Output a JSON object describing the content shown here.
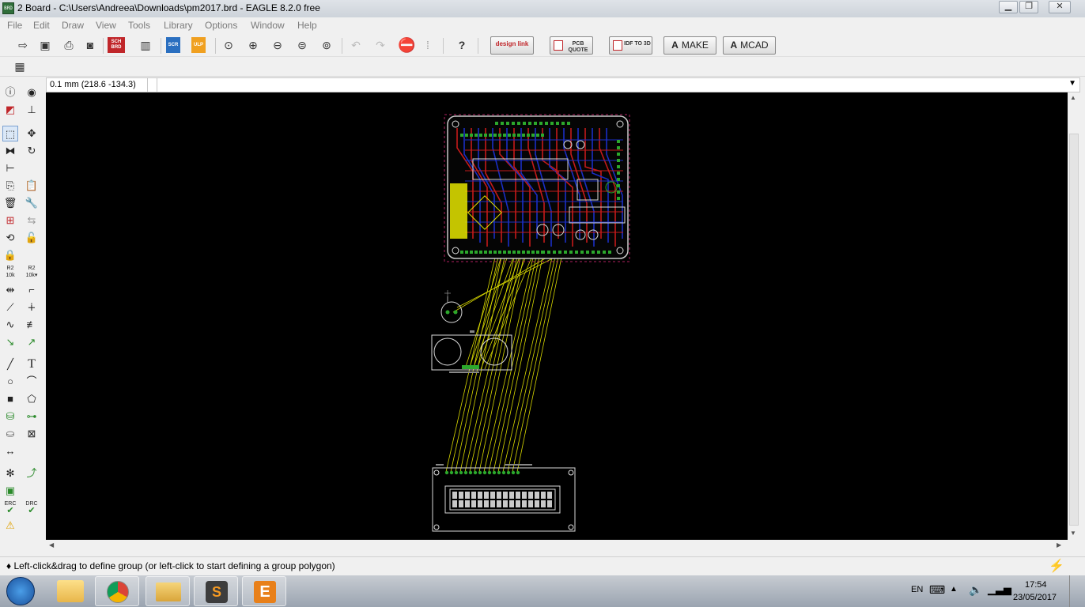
{
  "window": {
    "title": "2 Board - C:\\Users\\Andreea\\Downloads\\pm2017.brd - EAGLE 8.2.0 free",
    "app_icon_label": "BRD",
    "controls": [
      "minimize-icon",
      "restore-icon",
      "close-icon"
    ]
  },
  "menu": [
    "File",
    "Edit",
    "Draw",
    "View",
    "Tools",
    "Library",
    "Options",
    "Window",
    "Help"
  ],
  "toolbar": {
    "sch_brd_label": "SCH\nBRD",
    "scr_label": "SCR",
    "ulp_label": "ULP",
    "design_link_label": "design link",
    "pcb_quote_label": "PCB QUOTE",
    "idf_label": "IDF TO 3D",
    "make_label": "MAKE",
    "mcad_label": "MCAD",
    "help_icon": "question-icon"
  },
  "command_bar": {
    "coordinates": "0.1 mm (218.6 -134.3)",
    "command": ""
  },
  "left_tools": {
    "erc_label": "ERC",
    "drc_label": "DRC",
    "text_tool_label": "T"
  },
  "status": {
    "message": "♦ Left-click&drag to define group (or left-click to start defining a group polygon)"
  },
  "taskbar": {
    "language": "EN",
    "time": "17:54",
    "date": "23/05/2017",
    "apps": [
      "file-explorer-icon",
      "chrome-icon",
      "folder-icon",
      "sublime-text-icon",
      "eagle-icon"
    ]
  },
  "colors": {
    "canvas_bg": "#000000",
    "board_outline": "#c8c8c8",
    "airwire": "#d8d800",
    "top_trace": "#c41a1a",
    "bottom_trace": "#1a2ec4",
    "pad": "#2ca82c",
    "silk": "#d8d8d8",
    "label": "#e6e600"
  }
}
